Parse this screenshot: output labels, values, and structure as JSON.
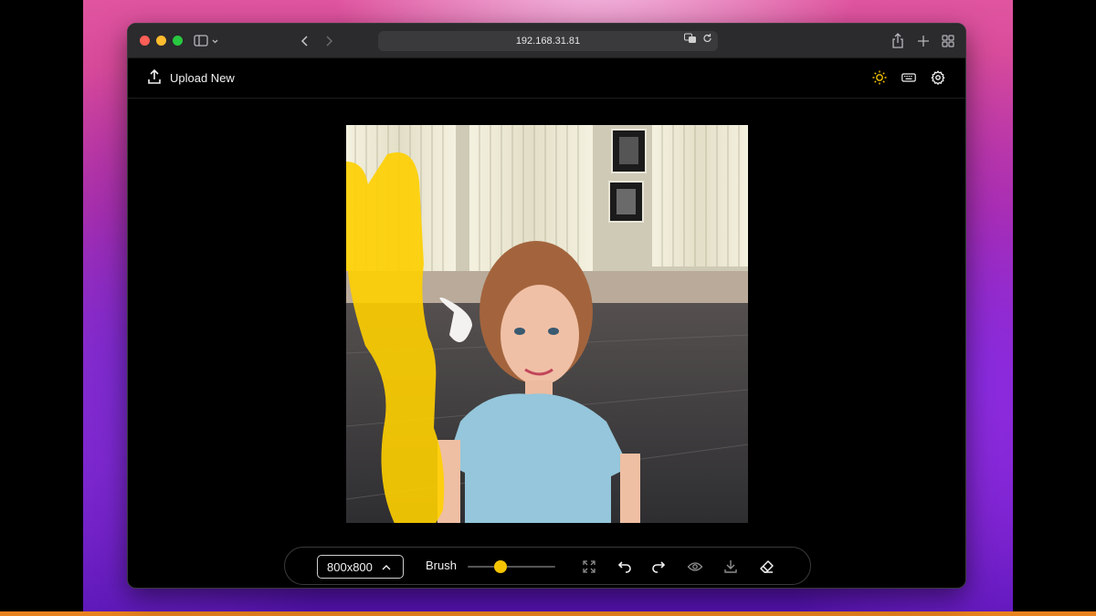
{
  "browser": {
    "url": "192.168.31.81"
  },
  "header": {
    "upload_label": "Upload New"
  },
  "toolbar": {
    "size_value": "800x800",
    "brush_label": "Brush",
    "brush_size_fraction": 0.38
  },
  "colors": {
    "accent": "#f5c400",
    "mask": "#ffd000"
  },
  "icons": {
    "upload": "upload-icon",
    "theme": "sun-icon",
    "shortcuts": "keyboard-icon",
    "settings": "gear-icon"
  }
}
